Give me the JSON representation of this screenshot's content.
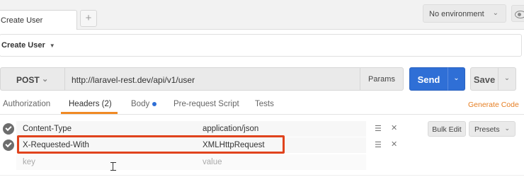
{
  "tabs": {
    "active_tab_label": "Create User",
    "add_tab_symbol": "+"
  },
  "environment": {
    "selected": "No environment",
    "eye_icon": "eye-icon"
  },
  "request": {
    "name": "Create User",
    "method": "POST",
    "url": "http://laravel-rest.dev/api/v1/user",
    "params_label": "Params",
    "send_label": "Send",
    "save_label": "Save"
  },
  "subtabs": {
    "authorization": "Authorization",
    "headers": "Headers (2)",
    "body": "Body",
    "prerequest": "Pre-request Script",
    "tests": "Tests",
    "generate_code": "Generate Code",
    "active": "headers",
    "accent_color": "#f08a24",
    "body_dot_color": "#2f6fd6"
  },
  "headers_table": {
    "rows": [
      {
        "key": "Content-Type",
        "value": "application/json",
        "enabled": true
      },
      {
        "key": "X-Requested-With",
        "value": "XMLHttpRequest",
        "enabled": true,
        "highlighted": true
      }
    ],
    "new_row": {
      "key_placeholder": "key",
      "value_placeholder": "value"
    },
    "bulk_edit_label": "Bulk Edit",
    "presets_label": "Presets"
  },
  "colors": {
    "send_button": "#2f6fd6",
    "highlight_box": "#e0431d"
  }
}
